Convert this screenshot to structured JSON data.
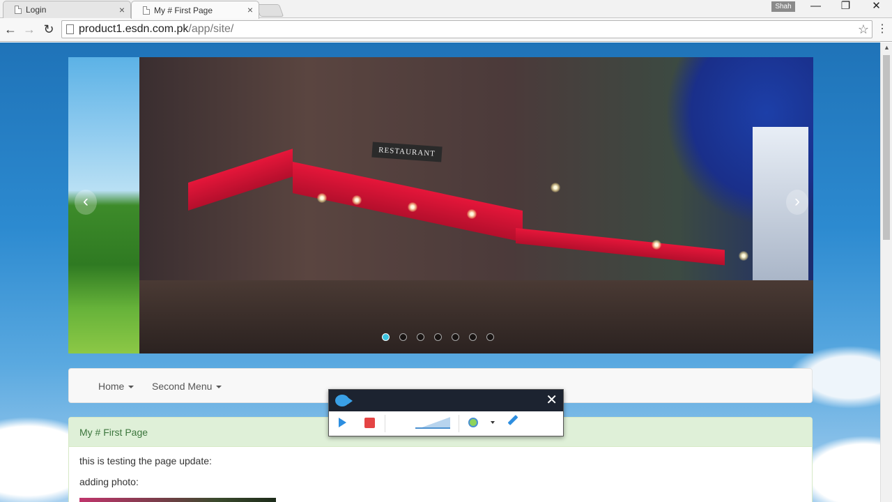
{
  "browser": {
    "tabs": [
      {
        "label": "Login"
      },
      {
        "label": "My # First Page"
      }
    ],
    "user_badge": "Shah",
    "window_buttons": {
      "minimize": "—",
      "restore": "❐",
      "close": "✕"
    },
    "url": {
      "host": "product1.esdn.com.pk",
      "path": "/app/site/"
    },
    "icons": {
      "back": "←",
      "forward": "→",
      "reload": "↻",
      "star": "☆",
      "menu": "⋮"
    }
  },
  "carousel": {
    "sign_text": "RESTAURANT",
    "prev_symbol": "‹",
    "next_symbol": "›",
    "indicator_count": 7,
    "active_indicator": 0
  },
  "navbar": {
    "items": [
      {
        "label": "Home"
      },
      {
        "label": "Second Menu"
      }
    ]
  },
  "panel": {
    "heading": "My # First Page",
    "lines": [
      "this is testing the page update:",
      "adding photo:"
    ]
  },
  "recorder": {
    "close_symbol": "✕"
  }
}
